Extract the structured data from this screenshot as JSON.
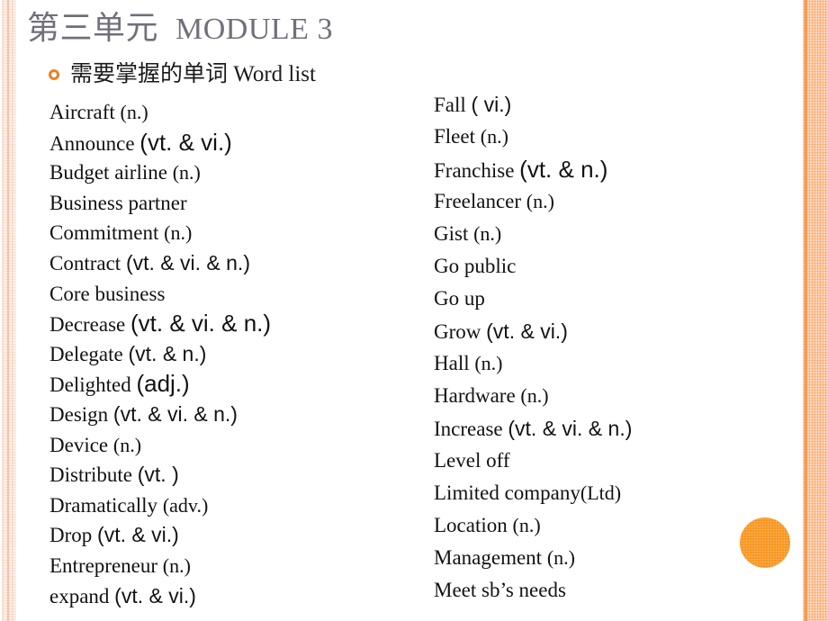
{
  "slide": {
    "title_cn": "第三单元",
    "title_en": "MODULE 3",
    "subtitle": "需要掌握的单词 Word list",
    "bullet_icon": "ring-bullet-icon",
    "accent_shape_icon": "orange-circle-decoration",
    "colors": {
      "title": "#70707c",
      "body_text": "#121212",
      "accent_orange": "#f7941e",
      "bullet_orange": "#ef7f23",
      "edge_pink": "#fdd9c4",
      "background": "#ffffff"
    }
  },
  "word_list": {
    "left_column": [
      {
        "headword": "Aircraft",
        "pos": "(n.)",
        "pos_style": "serif"
      },
      {
        "headword": "Announce",
        "pos": "(vt. & vi.)",
        "pos_style": "sans-lg"
      },
      {
        "headword": "Budget airline",
        "pos": "(n.)",
        "pos_style": "serif"
      },
      {
        "headword": "Business partner",
        "pos": "",
        "pos_style": "serif"
      },
      {
        "headword": "Commitment",
        "pos": "(n.)",
        "pos_style": "serif"
      },
      {
        "headword": "Contract",
        "pos": "(vt. & vi. & n.)",
        "pos_style": "sans"
      },
      {
        "headword": "Core business",
        "pos": "",
        "pos_style": "serif"
      },
      {
        "headword": "Decrease",
        "pos": "(vt. & vi. & n.)",
        "pos_style": "sans-lg"
      },
      {
        "headword": "Delegate",
        "pos": "(vt. & n.)",
        "pos_style": "sans"
      },
      {
        "headword": "Delighted",
        "pos": "(adj.)",
        "pos_style": "sans-lg"
      },
      {
        "headword": "Design",
        "pos": "(vt. & vi. & n.)",
        "pos_style": "sans"
      },
      {
        "headword": "Device",
        "pos": "(n.)",
        "pos_style": "serif"
      },
      {
        "headword": "Distribute",
        "pos": "(vt. )",
        "pos_style": "sans"
      },
      {
        "headword": "Dramatically",
        "pos": "(adv.)",
        "pos_style": "serif"
      },
      {
        "headword": "Drop",
        "pos": "(vt. & vi.)",
        "pos_style": "sans"
      },
      {
        "headword": "Entrepreneur",
        "pos": "(n.)",
        "pos_style": "serif"
      },
      {
        "headword": "expand",
        "pos": "(vt. & vi.)",
        "pos_style": "sans"
      }
    ],
    "right_column": [
      {
        "headword": "Fall",
        "pos": "( vi.)",
        "pos_style": "sans"
      },
      {
        "headword": "Fleet",
        "pos": "(n.)",
        "pos_style": "serif"
      },
      {
        "headword": "Franchise",
        "pos": "(vt. & n.)",
        "pos_style": "sans-lg"
      },
      {
        "headword": "Freelancer",
        "pos": "(n.)",
        "pos_style": "serif"
      },
      {
        "headword": "Gist",
        "pos": "(n.)",
        "pos_style": "serif"
      },
      {
        "headword": "Go public",
        "pos": "",
        "pos_style": "serif"
      },
      {
        "headword": "Go up",
        "pos": "",
        "pos_style": "serif"
      },
      {
        "headword": "Grow",
        "pos": "(vt. & vi.)",
        "pos_style": "sans"
      },
      {
        "headword": "Hall",
        "pos": "(n.)",
        "pos_style": "serif"
      },
      {
        "headword": "Hardware",
        "pos": "(n.)",
        "pos_style": "serif"
      },
      {
        "headword": "Increase",
        "pos": "(vt. & vi. & n.)",
        "pos_style": "sans"
      },
      {
        "headword": "Level off",
        "pos": "",
        "pos_style": "serif"
      },
      {
        "headword": "Limited company",
        "pos": "(Ltd)",
        "pos_style": "serif-tight"
      },
      {
        "headword": "Location",
        "pos": "(n.)",
        "pos_style": "serif"
      },
      {
        "headword": "Management",
        "pos": "(n.)",
        "pos_style": "serif"
      },
      {
        "headword": "Meet sb’s needs",
        "pos": "",
        "pos_style": "serif"
      }
    ]
  }
}
